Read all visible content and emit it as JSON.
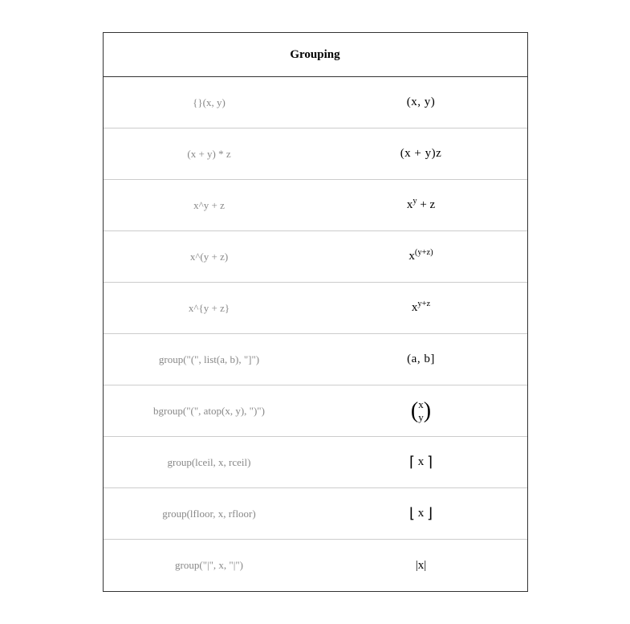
{
  "header": "Grouping",
  "rows": [
    {
      "syntax": "{}(x, y)",
      "renderKey": "r0"
    },
    {
      "syntax": "(x + y) * z",
      "renderKey": "r1"
    },
    {
      "syntax": "x^y + z",
      "renderKey": "r2"
    },
    {
      "syntax": "x^(y + z)",
      "renderKey": "r3"
    },
    {
      "syntax": "x^{y + z}",
      "renderKey": "r4"
    },
    {
      "syntax": "group(\"(\", list(a, b), \"]\")",
      "renderKey": "r5"
    },
    {
      "syntax": "bgroup(\"(\", atop(x, y), \")\")",
      "renderKey": "r6"
    },
    {
      "syntax": "group(lceil, x, rceil)",
      "renderKey": "r7"
    },
    {
      "syntax": "group(lfloor, x, rfloor)",
      "renderKey": "r8"
    },
    {
      "syntax": "group(\"|\", x, \"|\")",
      "renderKey": "r9"
    }
  ],
  "rendered": {
    "r0": "(x, y)",
    "r1": "(x + y)z",
    "r2_base": "x",
    "r2_sup": "y",
    "r2_rest": " + z",
    "r3_base": "x",
    "r3_sup": "(y+z)",
    "r4_base": "x",
    "r4_sup": "y+z",
    "r5": "(a, b]",
    "r6_top": "x",
    "r6_bot": "y",
    "r7_l": "⌈",
    "r7_mid": " x ",
    "r7_r": "⌉",
    "r8_l": "⌊",
    "r8_mid": " x ",
    "r8_r": "⌋",
    "r9_l": "|",
    "r9_mid": "x",
    "r9_r": "|"
  }
}
